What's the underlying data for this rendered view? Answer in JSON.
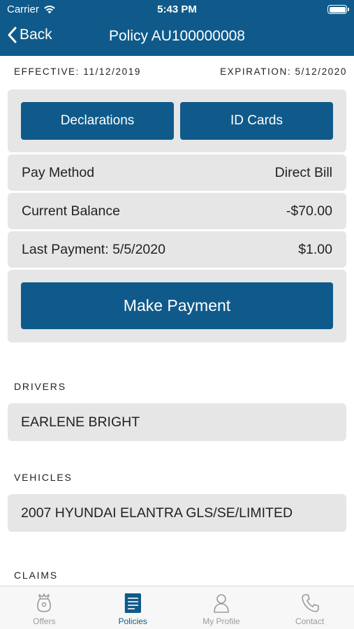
{
  "status": {
    "carrier": "Carrier",
    "time": "5:43 PM"
  },
  "nav": {
    "back_label": "Back",
    "title": "Policy AU100000008"
  },
  "policy": {
    "effective": "EFFECTIVE: 11/12/2019",
    "expiration": "EXPIRATION: 5/12/2020",
    "declarations_label": "Declarations",
    "id_cards_label": "ID Cards",
    "pay_method_label": "Pay Method",
    "pay_method_value": "Direct Bill",
    "current_balance_label": "Current Balance",
    "current_balance_value": "-$70.00",
    "last_payment_label": "Last Payment: 5/5/2020",
    "last_payment_value": "$1.00",
    "make_payment_label": "Make Payment"
  },
  "drivers": {
    "heading": "DRIVERS",
    "items": [
      "EARLENE BRIGHT"
    ]
  },
  "vehicles": {
    "heading": "VEHICLES",
    "items": [
      "2007 HYUNDAI ELANTRA GLS/SE/LIMITED"
    ]
  },
  "claims": {
    "heading": "CLAIMS"
  },
  "tabbar": {
    "items": [
      {
        "label": "Offers",
        "icon": "offers-icon"
      },
      {
        "label": "Policies",
        "icon": "policies-icon",
        "active": true
      },
      {
        "label": "My Profile",
        "icon": "profile-icon"
      },
      {
        "label": "Contact",
        "icon": "phone-icon"
      }
    ]
  },
  "colors": {
    "brand": "#0f5a8a",
    "card_bg": "#e6e6e6",
    "inactive_tab": "#9a9a9a"
  }
}
